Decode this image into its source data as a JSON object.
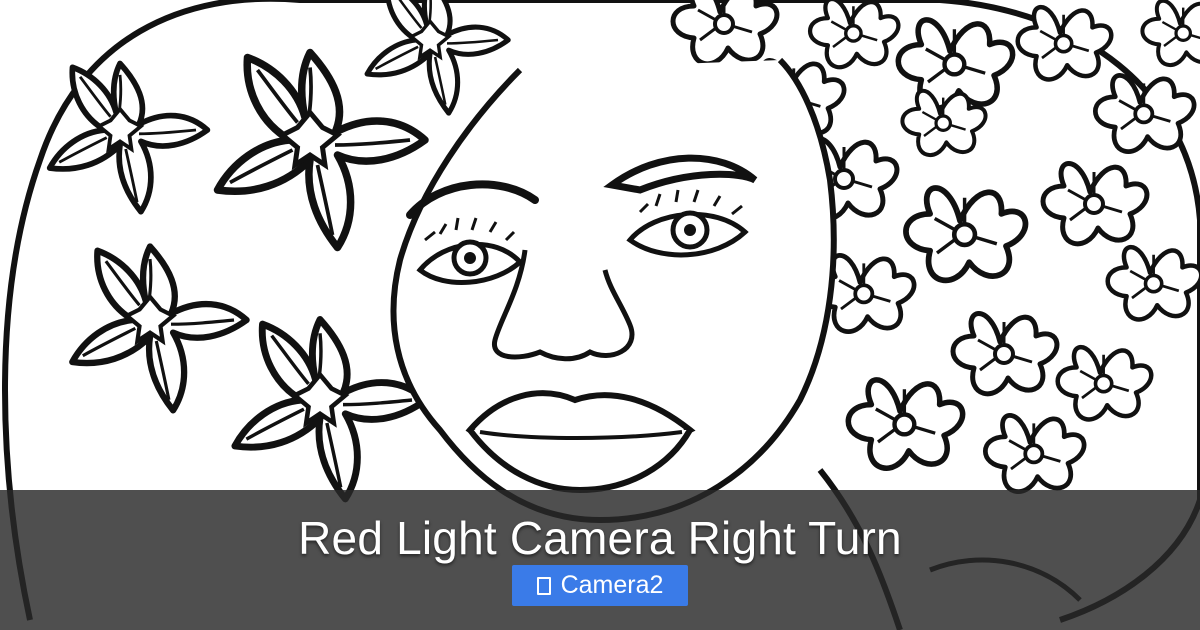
{
  "title": "Red Light Camera Right Turn",
  "tag": {
    "label": "Camera2",
    "icon": "box-icon"
  },
  "colors": {
    "overlay": "#282828",
    "button": "#3a7be8",
    "text": "#ffffff",
    "line_art": "#111111"
  }
}
